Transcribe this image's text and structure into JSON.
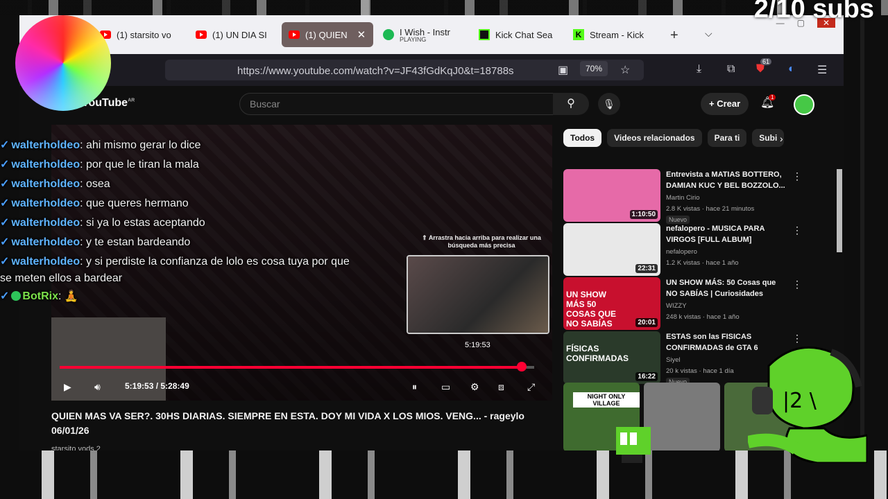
{
  "overlay": {
    "subs_text": "2/10 subs",
    "chat": [
      {
        "user": "walterholdeo",
        "message": "ahi mismo gerar lo dice"
      },
      {
        "user": "walterholdeo",
        "message": "por que le tiran la mala"
      },
      {
        "user": "walterholdeo",
        "message": "osea"
      },
      {
        "user": "walterholdeo",
        "message": "que queres hermano"
      },
      {
        "user": "walterholdeo",
        "message": "si ya lo estas aceptando"
      },
      {
        "user": "walterholdeo",
        "message": "y te estan bardeando"
      },
      {
        "user": "walterholdeo",
        "message": "y si perdiste la confianza de lolo es cosa tuya por que se meten ellos a bardear"
      },
      {
        "user": "BotRix",
        "message": "🧘"
      }
    ]
  },
  "browser": {
    "tabs": [
      {
        "label": "(1) starsito vo"
      },
      {
        "label": "(1) UN DIA SI"
      },
      {
        "label": "(1) QUIEN",
        "active": true
      },
      {
        "label": "I Wish - Instr",
        "sub": "PLAYING"
      },
      {
        "label": "Kick Chat Sea"
      },
      {
        "label": "Stream - Kick"
      }
    ],
    "url": "https://www.youtube.com/watch?v=JF43fGdKqJ0&t=18788s",
    "zoom": "70%",
    "extension_badge": "61"
  },
  "youtube": {
    "logo": "YouTube",
    "logo_region": "AR",
    "search_placeholder": "Buscar",
    "create_label": "Crear",
    "notification_count": "1",
    "player": {
      "pip_hint": "Arrastra hacia arriba para realizar una búsqueda más precisa",
      "hover_time": "5:19:53",
      "current_time": "5:19:53",
      "duration": "5:28:49",
      "progress": 0.973
    },
    "video_title": "QUIEN MAS VA SER?. 30HS DIARIAS. SIEMPRE EN ESTA. DOY MI VIDA X LOS MIOS. VENG... - rageylo 06/01/26",
    "channel": "starsito vods 2",
    "chips": [
      "Todos",
      "Videos relacionados",
      "Para ti",
      "Subi"
    ],
    "recommendations": [
      {
        "title": "Entrevista a MATIAS BOTTERO, DAMIAN KUC Y BEL BOZZOLO...",
        "channel": "Martin Cirio",
        "meta": "2.8 K vistas · hace 21 minutos",
        "badge": "Nuevo",
        "duration": "1:10:50",
        "thumb_color": "#e66aa8"
      },
      {
        "title": "nefalopero - MUSICA PARA VIRGOS [FULL ALBUM]",
        "channel": "nefalopero",
        "meta": "1.2 K vistas · hace 1 año",
        "badge": "",
        "duration": "22:31",
        "thumb_color": "#e8e8e8"
      },
      {
        "title": "UN SHOW MÁS: 50 Cosas que NO SABÍAS | Curiosidades",
        "channel": "WIZZY",
        "meta": "248 k vistas · hace 1 año",
        "badge": "",
        "duration": "20:01",
        "thumb_color": "#c8102e",
        "thumb_text": "UN SHOW MÁS 50 COSAS QUE NO SABÍAS"
      },
      {
        "title": "ESTAS son las FISICAS CONFIRMADAS de GTA 6",
        "channel": "Siyel",
        "meta": "20 k vistas · hace 1 día",
        "badge": "Nuevo",
        "duration": "16:22",
        "thumb_color": "#2a3a2a",
        "thumb_text": "FÍSICAS CONFIRMADAS"
      }
    ],
    "shorts": [
      {
        "label": "NIGHT ONLY VILLAGE",
        "color": "#3f6b2f"
      },
      {
        "label": "",
        "color": "#7a7a7a"
      },
      {
        "label": "",
        "color": "#4a6a3a"
      }
    ]
  },
  "colors": {
    "accent_red": "#ff0033",
    "chat_user": "#5fb4ff",
    "bot_user": "#7be04a",
    "mascot_green": "#5fd12a"
  }
}
